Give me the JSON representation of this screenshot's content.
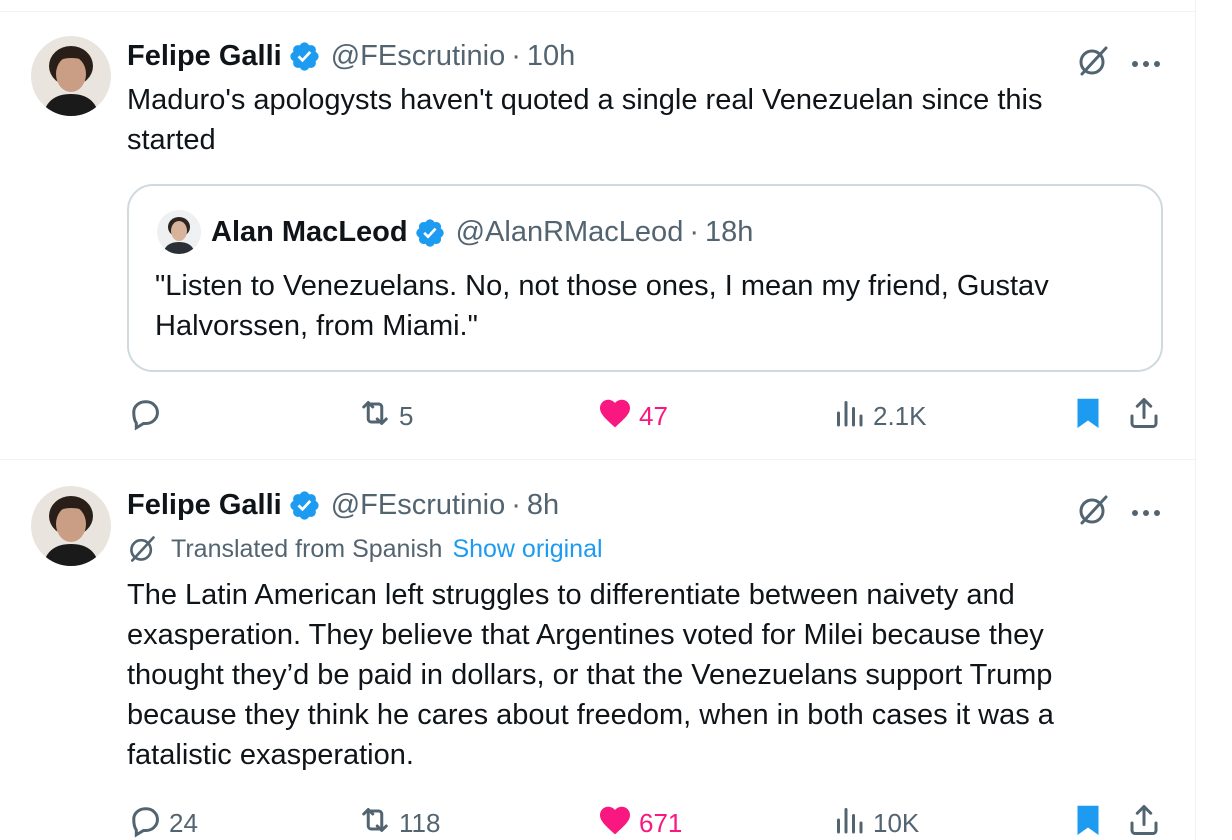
{
  "tweets": [
    {
      "author_name": "Felipe Galli",
      "handle": "@FEscrutinio",
      "separator": "·",
      "time": "10h",
      "text": "Maduro's apologysts haven't quoted a single real Venezuelan since this started",
      "quote": {
        "author_name": "Alan MacLeod",
        "handle": "@AlanRMacLeod",
        "separator": "·",
        "time": "18h",
        "text": "\"Listen to Venezuelans. No, not those ones, I mean my friend, Gustav Halvorssen, from Miami.\""
      },
      "actions": {
        "replies": "",
        "retweets": "5",
        "likes": "47",
        "views": "2.1K"
      }
    },
    {
      "author_name": "Felipe Galli",
      "handle": "@FEscrutinio",
      "separator": "·",
      "time": "8h",
      "translated_label": "Translated from Spanish",
      "show_original": "Show original",
      "text": "The Latin American left struggles to differentiate between naivety and exasperation. They believe that Argentines voted for Milei because they thought they’d be paid in dollars, or that the Venezuelans support Trump because they think he cares about freedom, when in both cases it was a fatalistic exasperation.",
      "actions": {
        "replies": "24",
        "retweets": "118",
        "likes": "671",
        "views": "10K"
      }
    }
  ],
  "colors": {
    "verified": "#1d9bf0",
    "like_active": "#f91880",
    "bookmark_active": "#1d9bf0",
    "secondary_text": "#536471",
    "link": "#1d9bf0"
  },
  "icons": [
    "verified-badge-icon",
    "grok-icon",
    "more-icon",
    "reply-icon",
    "retweet-icon",
    "like-icon",
    "views-icon",
    "bookmark-icon",
    "share-icon"
  ]
}
